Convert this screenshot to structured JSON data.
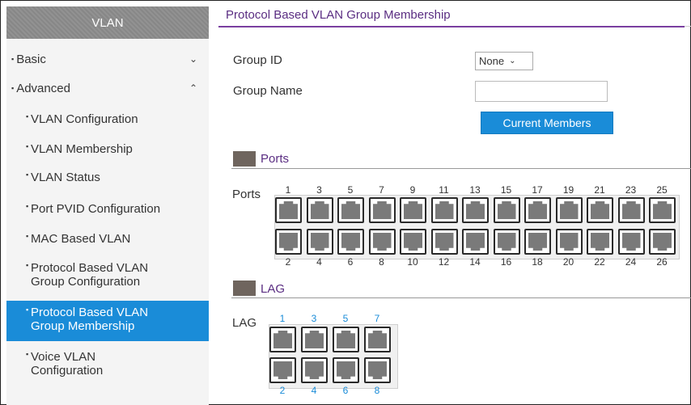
{
  "sidebar": {
    "header": "VLAN",
    "groups": [
      {
        "label": "Basic",
        "chevron": "⌄"
      },
      {
        "label": "Advanced",
        "chevron": "⌃"
      }
    ],
    "items": [
      {
        "label": "VLAN Configuration"
      },
      {
        "label": "VLAN Membership"
      },
      {
        "label": "VLAN Status"
      },
      {
        "label": "Port PVID Configuration"
      },
      {
        "label": "MAC Based VLAN"
      },
      {
        "label": "Protocol Based VLAN",
        "label2": "Group Configuration"
      },
      {
        "label": "Protocol Based VLAN",
        "label2": "Group Membership"
      },
      {
        "label": "Voice VLAN",
        "label2": "Configuration"
      }
    ],
    "active_item": "Protocol Based VLAN Group Membership"
  },
  "main": {
    "title": "Protocol Based VLAN Group Membership",
    "group_id_label": "Group ID",
    "group_id_value": "None",
    "group_name_label": "Group Name",
    "group_name_value": "",
    "current_members_button": "Current Members",
    "ports_section": {
      "title": "Ports",
      "row_label": "Ports",
      "top_numbers": [
        "1",
        "3",
        "5",
        "7",
        "9",
        "11",
        "13",
        "15",
        "17",
        "19",
        "21",
        "23",
        "25"
      ],
      "bottom_numbers": [
        "2",
        "4",
        "6",
        "8",
        "10",
        "12",
        "14",
        "16",
        "18",
        "20",
        "22",
        "24",
        "26"
      ]
    },
    "lag_section": {
      "title": "LAG",
      "row_label": "LAG",
      "top_numbers": [
        "1",
        "3",
        "5",
        "7"
      ],
      "bottom_numbers": [
        "2",
        "4",
        "6",
        "8"
      ]
    }
  },
  "colors": {
    "accent_blue": "#1a8cd8",
    "title_purple": "#5a2d82",
    "title_rule": "#7a3fa0",
    "sidebar_header": "#8c8c8c"
  }
}
